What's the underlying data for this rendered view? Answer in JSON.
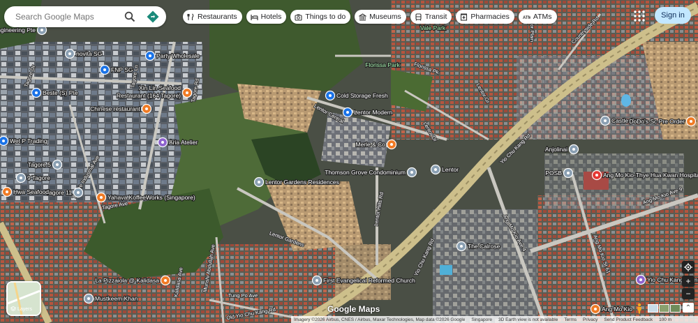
{
  "search": {
    "placeholder": "Search Google Maps"
  },
  "chips": [
    {
      "label": "Restaurants",
      "icon": "fork-knife-icon"
    },
    {
      "label": "Hotels",
      "icon": "bed-icon"
    },
    {
      "label": "Things to do",
      "icon": "camera-icon"
    },
    {
      "label": "Museums",
      "icon": "museum-icon"
    },
    {
      "label": "Transit",
      "icon": "train-icon"
    },
    {
      "label": "Pharmacies",
      "icon": "pharmacy-icon"
    },
    {
      "label": "ATMs",
      "icon": "atm-icon"
    }
  ],
  "signin": "Sign in",
  "layers_label": "Layers",
  "google_logo": "Google Maps",
  "footer": {
    "imagery": "Imagery ©2026 Airbus, CNES / Airbus, Maxar Technologies, Map data ©2026 Google",
    "country": "Singapore",
    "earth": "3D Earth view is not available",
    "terms": "Terms",
    "privacy": "Privacy",
    "feedback": "Send Product Feedback",
    "scale": "100 m"
  },
  "places": [
    {
      "name": "Engineering Pte",
      "kind": "business"
    },
    {
      "name": "novita SG",
      "kind": "business"
    },
    {
      "name": "Party Wholesale",
      "kind": "shop"
    },
    {
      "name": "FNP SG",
      "kind": "shop"
    },
    {
      "name": "Xin Lin Seafood",
      "kind": "food"
    },
    {
      "name": "Restaurant (164 Tagore)",
      "kind": "food"
    },
    {
      "name": "Chinese restaurant",
      "kind": "food"
    },
    {
      "name": "Beste (S) Pte",
      "kind": "shop"
    },
    {
      "name": "Aria Atelier",
      "kind": "service"
    },
    {
      "name": "Wet P Trading",
      "kind": "shop"
    },
    {
      "name": "Tagore 5",
      "kind": "business"
    },
    {
      "name": "Tagore 11",
      "kind": "business"
    },
    {
      "name": "9 Tagore",
      "kind": "business"
    },
    {
      "name": "Hwa Seafood",
      "kind": "food"
    },
    {
      "name": "Yahava KoffeeWorks (Singapore)",
      "kind": "food"
    },
    {
      "name": "Lentor Gardens Residences",
      "kind": "business"
    },
    {
      "name": "Cold Storage Fresh",
      "kind": "shop"
    },
    {
      "name": "Lentor Modern",
      "kind": "shop"
    },
    {
      "name": "Merle & Co",
      "kind": "food"
    },
    {
      "name": "Thomson Grove Condominium",
      "kind": "business"
    },
    {
      "name": "Lentor",
      "kind": "transit"
    },
    {
      "name": "Florissa Park",
      "kind": "park"
    },
    {
      "name": "Vale Park",
      "kind": "park"
    },
    {
      "name": "Castle Green",
      "kind": "business"
    },
    {
      "name": "DoDo's Sc Pre Order",
      "kind": "food"
    },
    {
      "name": "Anjolinai",
      "kind": "business"
    },
    {
      "name": "POSB",
      "kind": "atm"
    },
    {
      "name": "Ang Mo Kio-Thye Hua Kwan Hospital",
      "kind": "hospital"
    },
    {
      "name": "The Calrose",
      "kind": "business"
    },
    {
      "name": "La Pizzaiola @ Kalidasa",
      "kind": "food"
    },
    {
      "name": "Mustkeem Khan",
      "kind": "business"
    },
    {
      "name": "First Evangelical Reformed Church",
      "kind": "business"
    },
    {
      "name": "Yio Chu Kang Community C",
      "kind": "service"
    },
    {
      "name": "Ang Mo Kio",
      "kind": "food"
    }
  ],
  "roads": [
    "Tagore Dr",
    "Tagore Ln",
    "Tagore Rd",
    "Tagore Ave",
    "Tagore Industrial Ave",
    "Lentor Central",
    "Lentor Dr",
    "Lentor Hills Rd",
    "Lentor Gardens",
    "Florissa Pk",
    "Yio Chu Kang Rd",
    "Ang Mo Kio Ave 9",
    "Ang Mo Kio Ave 4",
    "Ang Mo Kio St 61",
    "Countryside Rd",
    "Lentor Plain",
    "Lentor Gr",
    "Kalidasa Ave",
    "Munshi Abdullah Ave",
    "Tung Po Ave",
    "Old Yio Chu Kang Rd",
    "Yio Chu Kang Rd"
  ],
  "colors": {
    "food": "#f07b25",
    "shop": "#1a73e8",
    "service": "#8e63ce",
    "business": "#8ba0b3",
    "hospital": "#e53935",
    "park": "#a9f5b0"
  }
}
